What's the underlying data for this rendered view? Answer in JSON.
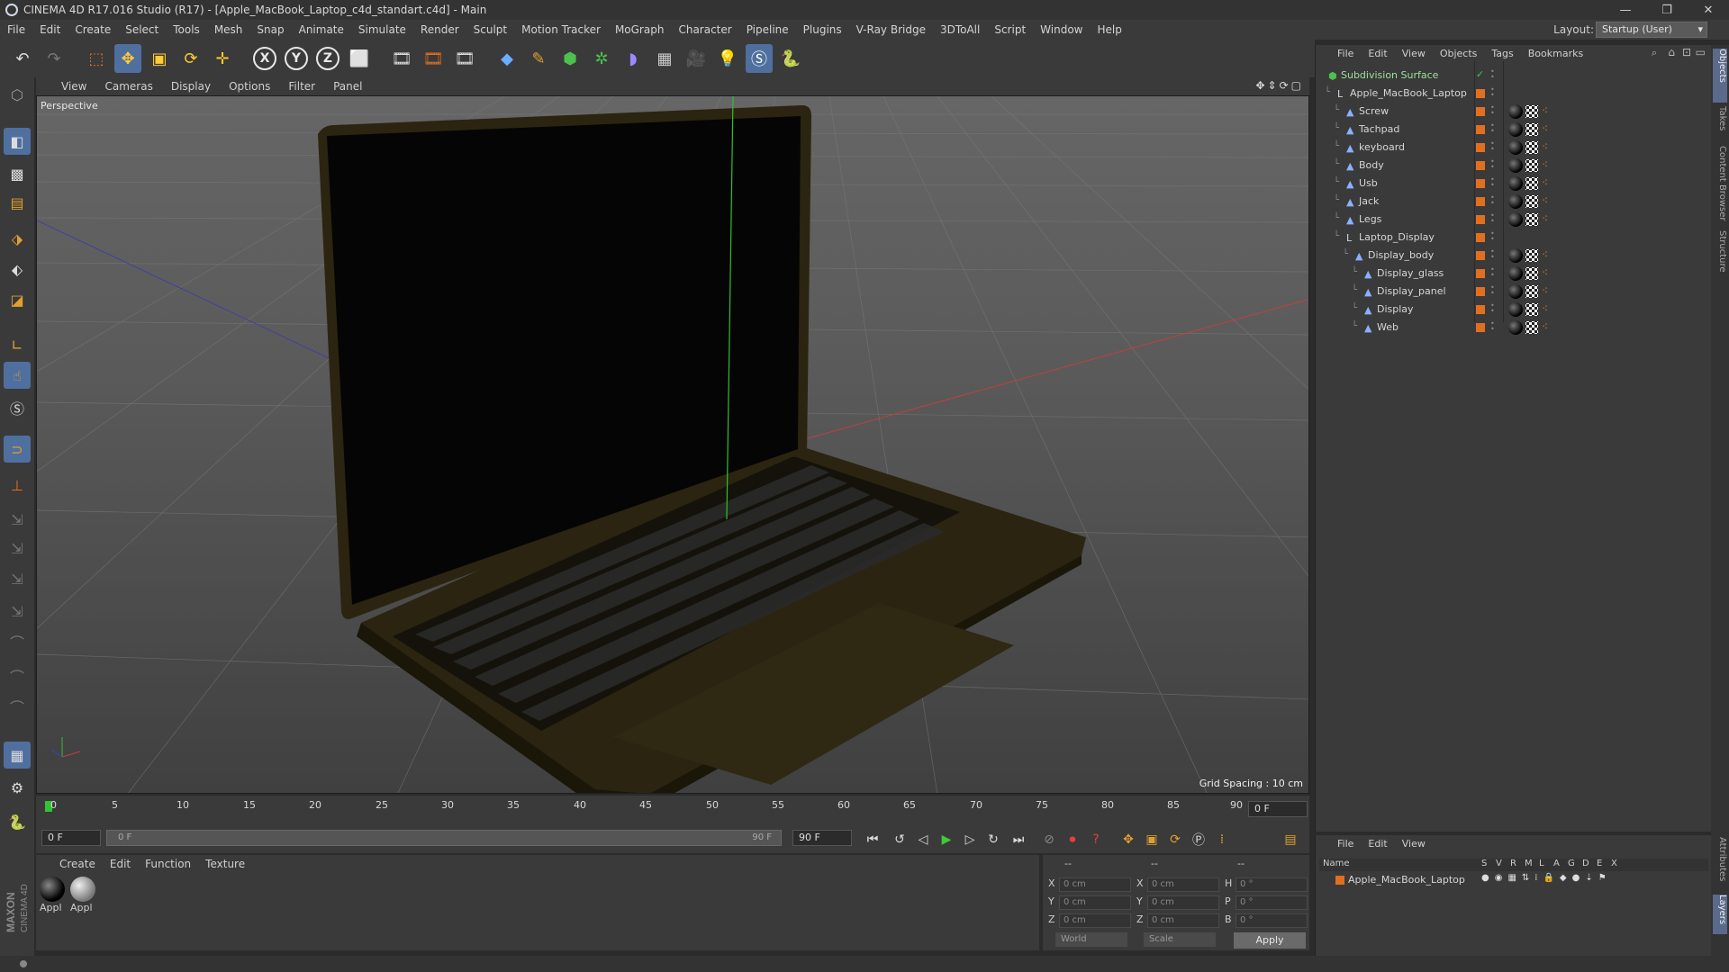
{
  "window": {
    "title": "CINEMA 4D R17.016 Studio (R17) - [Apple_MacBook_Laptop_c4d_standart.c4d] - Main",
    "controls": [
      "—",
      "❐",
      "✕"
    ]
  },
  "menubar": {
    "items": [
      "File",
      "Edit",
      "Create",
      "Select",
      "Tools",
      "Mesh",
      "Snap",
      "Animate",
      "Simulate",
      "Render",
      "Sculpt",
      "Motion Tracker",
      "MoGraph",
      "Character",
      "Pipeline",
      "Plugins",
      "V-Ray Bridge",
      "3DToAll",
      "Script",
      "Window",
      "Help"
    ],
    "layout_label": "Layout:",
    "layout_value": "Startup (User)"
  },
  "toolbar": {
    "axes": [
      "X",
      "Y",
      "Z"
    ]
  },
  "viewport": {
    "menu": [
      "View",
      "Cameras",
      "Display",
      "Options",
      "Filter",
      "Panel"
    ],
    "label": "Perspective",
    "grid_spacing": "Grid Spacing : 10 cm"
  },
  "timeline": {
    "ticks": [
      "0",
      "5",
      "10",
      "15",
      "20",
      "25",
      "30",
      "35",
      "40",
      "45",
      "50",
      "55",
      "60",
      "65",
      "70",
      "75",
      "80",
      "85",
      "90"
    ],
    "frame_end": "0 F",
    "current_frame": "0 F",
    "range_start": "0 F",
    "range_end": "90 F",
    "max_frame": "90 F"
  },
  "material_manager": {
    "menu": [
      "Create",
      "Edit",
      "Function",
      "Texture"
    ],
    "materials": [
      {
        "name": "Appl",
        "color": "#111111"
      },
      {
        "name": "Appl",
        "color": "#9a9a9a"
      }
    ]
  },
  "coordinates": {
    "header": [
      "--",
      "--",
      "--"
    ],
    "rows": [
      {
        "pos_label": "X",
        "pos": "0 cm",
        "size_label": "X",
        "size": "0 cm",
        "rot_label": "H",
        "rot": "0 °"
      },
      {
        "pos_label": "Y",
        "pos": "0 cm",
        "size_label": "Y",
        "size": "0 cm",
        "rot_label": "P",
        "rot": "0 °"
      },
      {
        "pos_label": "Z",
        "pos": "0 cm",
        "size_label": "Z",
        "size": "0 cm",
        "rot_label": "B",
        "rot": "0 °"
      }
    ],
    "mode": "World",
    "size_mode": "Scale",
    "apply": "Apply"
  },
  "object_manager": {
    "menu": [
      "File",
      "Edit",
      "View",
      "Objects",
      "Tags",
      "Bookmarks"
    ],
    "objects": [
      {
        "name": "Subdivision Surface",
        "indent": 0,
        "icon": "subdiv",
        "tags": false
      },
      {
        "name": "Apple_MacBook_Laptop",
        "indent": 1,
        "icon": "null",
        "tags": false
      },
      {
        "name": "Screw",
        "indent": 2,
        "icon": "poly",
        "tags": true
      },
      {
        "name": "Tachpad",
        "indent": 2,
        "icon": "poly",
        "tags": true
      },
      {
        "name": "keyboard",
        "indent": 2,
        "icon": "poly",
        "tags": true
      },
      {
        "name": "Body",
        "indent": 2,
        "icon": "poly",
        "tags": true
      },
      {
        "name": "Usb",
        "indent": 2,
        "icon": "poly",
        "tags": true
      },
      {
        "name": "Jack",
        "indent": 2,
        "icon": "poly",
        "tags": true
      },
      {
        "name": "Legs",
        "indent": 2,
        "icon": "poly",
        "tags": true
      },
      {
        "name": "Laptop_Display",
        "indent": 2,
        "icon": "null",
        "tags": false
      },
      {
        "name": "Display_body",
        "indent": 3,
        "icon": "poly",
        "tags": true
      },
      {
        "name": "Display_glass",
        "indent": 4,
        "icon": "poly",
        "tags": true
      },
      {
        "name": "Display_panel",
        "indent": 4,
        "icon": "poly",
        "tags": true
      },
      {
        "name": "Display",
        "indent": 4,
        "icon": "poly",
        "tags": true
      },
      {
        "name": "Web",
        "indent": 4,
        "icon": "poly",
        "tags": true
      }
    ]
  },
  "layer_manager": {
    "menu": [
      "File",
      "Edit",
      "View"
    ],
    "columns": [
      "Name",
      "S",
      "V",
      "R",
      "M",
      "L",
      "A",
      "G",
      "D",
      "E",
      "X"
    ],
    "layer_name": "Apple_MacBook_Laptop"
  },
  "right_tabs": [
    "Objects",
    "Takes",
    "Content Browser",
    "Structure",
    "Attributes",
    "Layers"
  ],
  "brand": {
    "maxon": "MAXON",
    "cinema": "CINEMA 4D",
    "accent": "#4f6f9f",
    "orange": "#e07020"
  }
}
